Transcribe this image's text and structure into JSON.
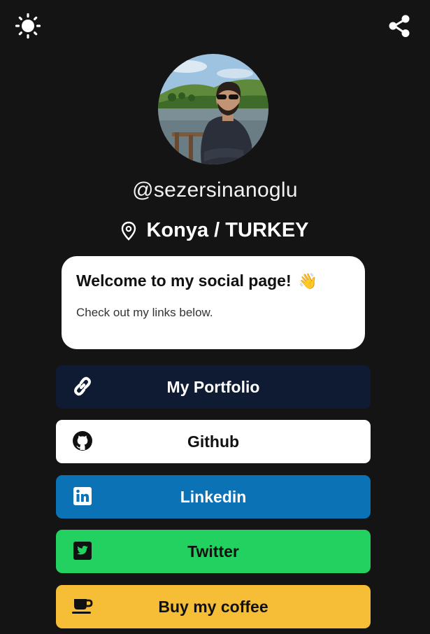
{
  "header": {
    "theme_icon": "sun-icon",
    "share_icon": "share-icon"
  },
  "profile": {
    "username": "@sezersinanoglu",
    "location": "Konya / TURKEY",
    "location_icon": "map-pin-icon"
  },
  "welcome": {
    "title": "Welcome to my social page!",
    "emoji": "👋",
    "subtitle": "Check out my links below."
  },
  "links": [
    {
      "label": "My Portfolio",
      "icon": "link-icon",
      "bg": "#0f1b33",
      "fg": "#ffffff"
    },
    {
      "label": "Github",
      "icon": "github-icon",
      "bg": "#ffffff",
      "fg": "#111111"
    },
    {
      "label": "Linkedin",
      "icon": "linkedin-icon",
      "bg": "#0a72b5",
      "fg": "#ffffff"
    },
    {
      "label": "Twitter",
      "icon": "twitter-icon",
      "bg": "#22d15f",
      "fg": "#111111"
    },
    {
      "label": "Buy my coffee",
      "icon": "coffee-icon",
      "bg": "#f6bd37",
      "fg": "#111111"
    }
  ]
}
